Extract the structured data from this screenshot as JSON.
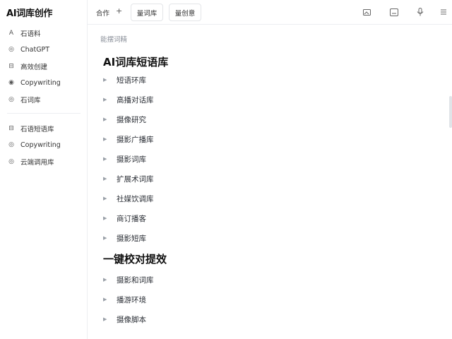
{
  "app": {
    "title": "AI词库创作"
  },
  "sidebar": {
    "group1": [
      {
        "icon": "A",
        "label": "石语料"
      },
      {
        "icon": "◎",
        "label": "ChatGPT"
      },
      {
        "icon": "⊟",
        "label": "高效创建"
      },
      {
        "icon": "◉",
        "label": "Copywriting"
      },
      {
        "icon": "◎",
        "label": "石词库"
      }
    ],
    "group2": [
      {
        "icon": "⊟",
        "label": "石语短语库"
      },
      {
        "icon": "◎",
        "label": "Copywriting"
      },
      {
        "icon": "◎",
        "label": "云端调用库"
      }
    ]
  },
  "toolbar": {
    "label": "合作",
    "btn1": "量词库",
    "btn2": "量创意"
  },
  "main": {
    "breadcrumb": "能摆词精",
    "section1": {
      "title": "AI词库短语库",
      "items": [
        "短语环库",
        "高播对话库",
        "摄像研究",
        "摄影广播库",
        "摄影词库",
        "扩展术词库",
        "社媒饮调库",
        "商订播客",
        "摄影短库"
      ]
    },
    "section2": {
      "title": "一键校对提效",
      "items": [
        "摄影和词库",
        "播游环境",
        "摄像脚本"
      ]
    }
  }
}
